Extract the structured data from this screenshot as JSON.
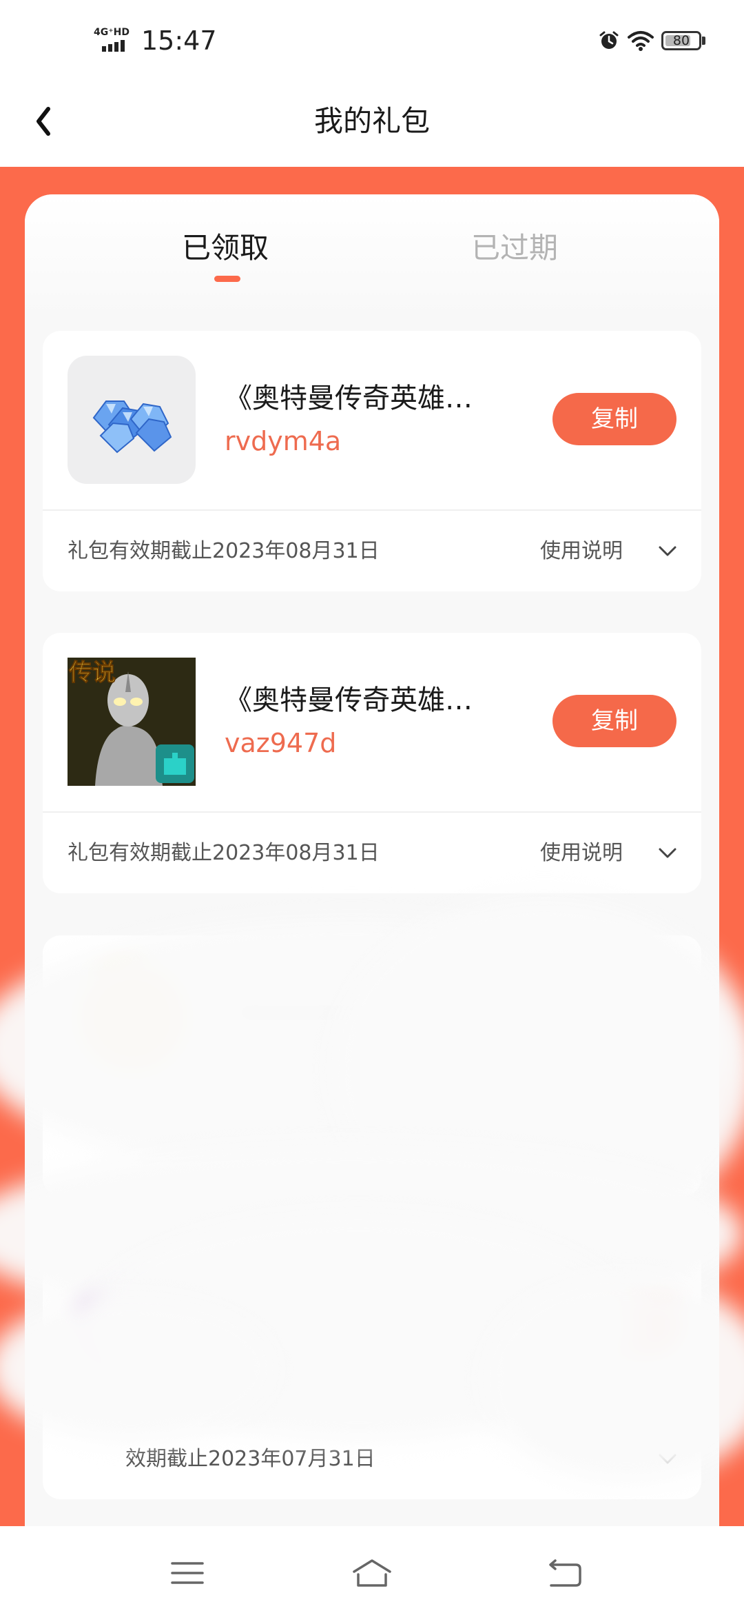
{
  "status_bar": {
    "network": "4G⁺HD",
    "time": "15:47",
    "battery": "80",
    "battery_level": 0.8
  },
  "header": {
    "title": "我的礼包",
    "back_icon": "chevron-left-icon"
  },
  "tabs": [
    {
      "label": "已领取",
      "active": true
    },
    {
      "label": "已过期",
      "active": false
    }
  ],
  "gifts": [
    {
      "title": "《奥特曼传奇英雄…",
      "code": "rvdym4a",
      "copy_label": "复制",
      "expiry": "礼包有效期截止2023年08月31日",
      "usage_label": "使用说明",
      "icon": "blue-diamonds-icon"
    },
    {
      "title": "《奥特曼传奇英雄…",
      "code": "vaz947d",
      "copy_label": "复制",
      "expiry": "礼包有效期截止2023年08月31日",
      "usage_label": "使用说明",
      "icon": "ultraman-legend-icon",
      "icon_badge": "传说"
    }
  ],
  "obscured": {
    "expiry_partial": "效期截止2023年07月31日"
  },
  "nav": {
    "menu_icon": "menu-icon",
    "home_icon": "home-icon",
    "back_icon": "return-icon"
  },
  "colors": {
    "accent": "#fc6a4b",
    "button": "#f5694a",
    "code_text": "#ee6b4f"
  }
}
